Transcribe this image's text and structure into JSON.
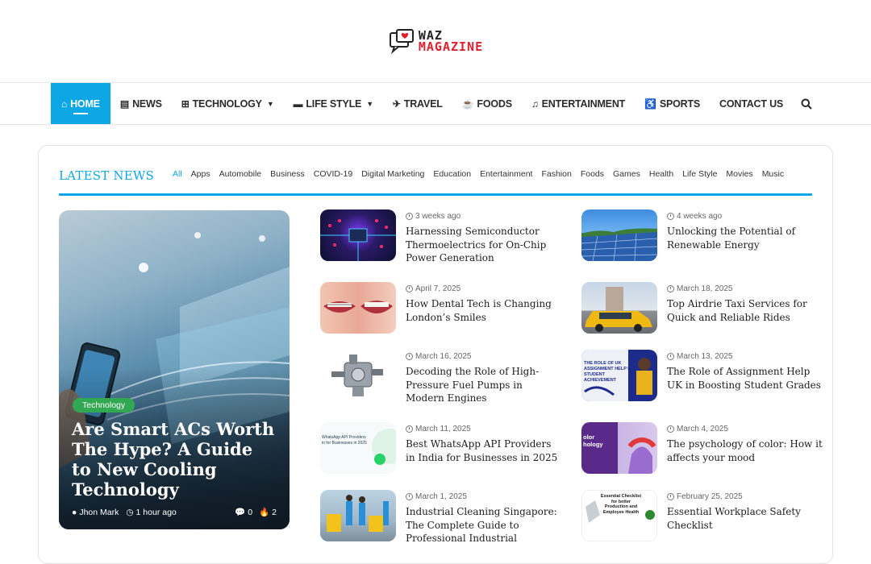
{
  "brand": {
    "line1": "WAZ",
    "line2": "MAGAZINE"
  },
  "nav": {
    "items": [
      {
        "label": "HOME",
        "icon": "home-icon",
        "active": true
      },
      {
        "label": "NEWS",
        "icon": "newspaper-icon"
      },
      {
        "label": "TECHNOLOGY",
        "icon": "grid-icon",
        "dropdown": true
      },
      {
        "label": "LIFE STYLE",
        "icon": "car-icon",
        "dropdown": true
      },
      {
        "label": "TRAVEL",
        "icon": "plane-icon"
      },
      {
        "label": "FOODS",
        "icon": "coffee-icon"
      },
      {
        "label": "ENTERTAINMENT",
        "icon": "music-icon"
      },
      {
        "label": "SPORTS",
        "icon": "wheelchair-icon"
      },
      {
        "label": "CONTACT US",
        "icon": ""
      }
    ]
  },
  "latest": {
    "title": "LATEST NEWS",
    "tabs": [
      "All",
      "Apps",
      "Automobile",
      "Business",
      "COVID-19",
      "Digital Marketing",
      "Education",
      "Entertainment",
      "Fashion",
      "Foods",
      "Games",
      "Health",
      "Life Style",
      "Movies",
      "Music"
    ]
  },
  "featured": {
    "category": "Technology",
    "title": "Are Smart ACs Worth The Hype? A Guide to New Cooling Technology",
    "author": "Jhon Mark",
    "time": "1 hour ago",
    "comments": "0",
    "views": "2"
  },
  "posts_col1": [
    {
      "date": "3 weeks ago",
      "title": "Harnessing Semiconductor Thermoelectrics for On-Chip Power Generation"
    },
    {
      "date": "April 7, 2025",
      "title": "How Dental Tech is Changing London’s Smiles"
    },
    {
      "date": "March 16, 2025",
      "title": "Decoding the Role of High-Pressure Fuel Pumps in Modern Engines"
    },
    {
      "date": "March 11, 2025",
      "title": "Best WhatsApp API Providers in India for Businesses in 2025"
    },
    {
      "date": "March 1, 2025",
      "title": "Industrial Cleaning Singapore: The Complete Guide to Professional Industrial"
    }
  ],
  "posts_col2": [
    {
      "date": "4 weeks ago",
      "title": "Unlocking the Potential of Renewable Energy"
    },
    {
      "date": "March 18, 2025",
      "title": "Top Airdrie Taxi Services for Quick and Reliable Rides"
    },
    {
      "date": "March 13, 2025",
      "title": "The Role of Assignment Help UK in Boosting Student Grades"
    },
    {
      "date": "March 4, 2025",
      "title": "The psychology of color: How it affects your mood"
    },
    {
      "date": "February 25, 2025",
      "title": "Essential Workplace Safety Checklist"
    }
  ],
  "thumb_text": {
    "t3": "THE ROLE OF UK ASSIGNMENT HELP IN STUDENT ACHIEVEMENT",
    "t4": "WhatsApp API Providers in for Businesses in 2025",
    "t5": "olor hology",
    "t6": "Essential Checklist for better Production and Employee Health"
  },
  "colors": {
    "accent": "#0ea7e6",
    "badge": "#33a852",
    "brand_red": "#e0202e"
  }
}
